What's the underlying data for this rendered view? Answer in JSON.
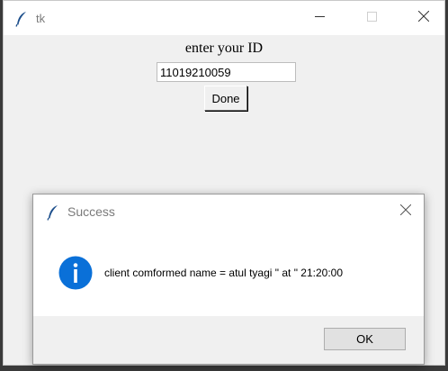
{
  "main_window": {
    "title": "tk",
    "id_label": "enter your ID",
    "id_value": "11019210059",
    "done_label": "Done"
  },
  "dialog": {
    "title": "Success",
    "message": "client comformed name = atul tyagi \" at \" 21:20:00",
    "ok_label": "OK",
    "icon": "info-icon"
  },
  "colors": {
    "info_blue": "#0a70d8",
    "window_bg": "#f0f0f0",
    "feather_blue": "#2a5c9a"
  }
}
